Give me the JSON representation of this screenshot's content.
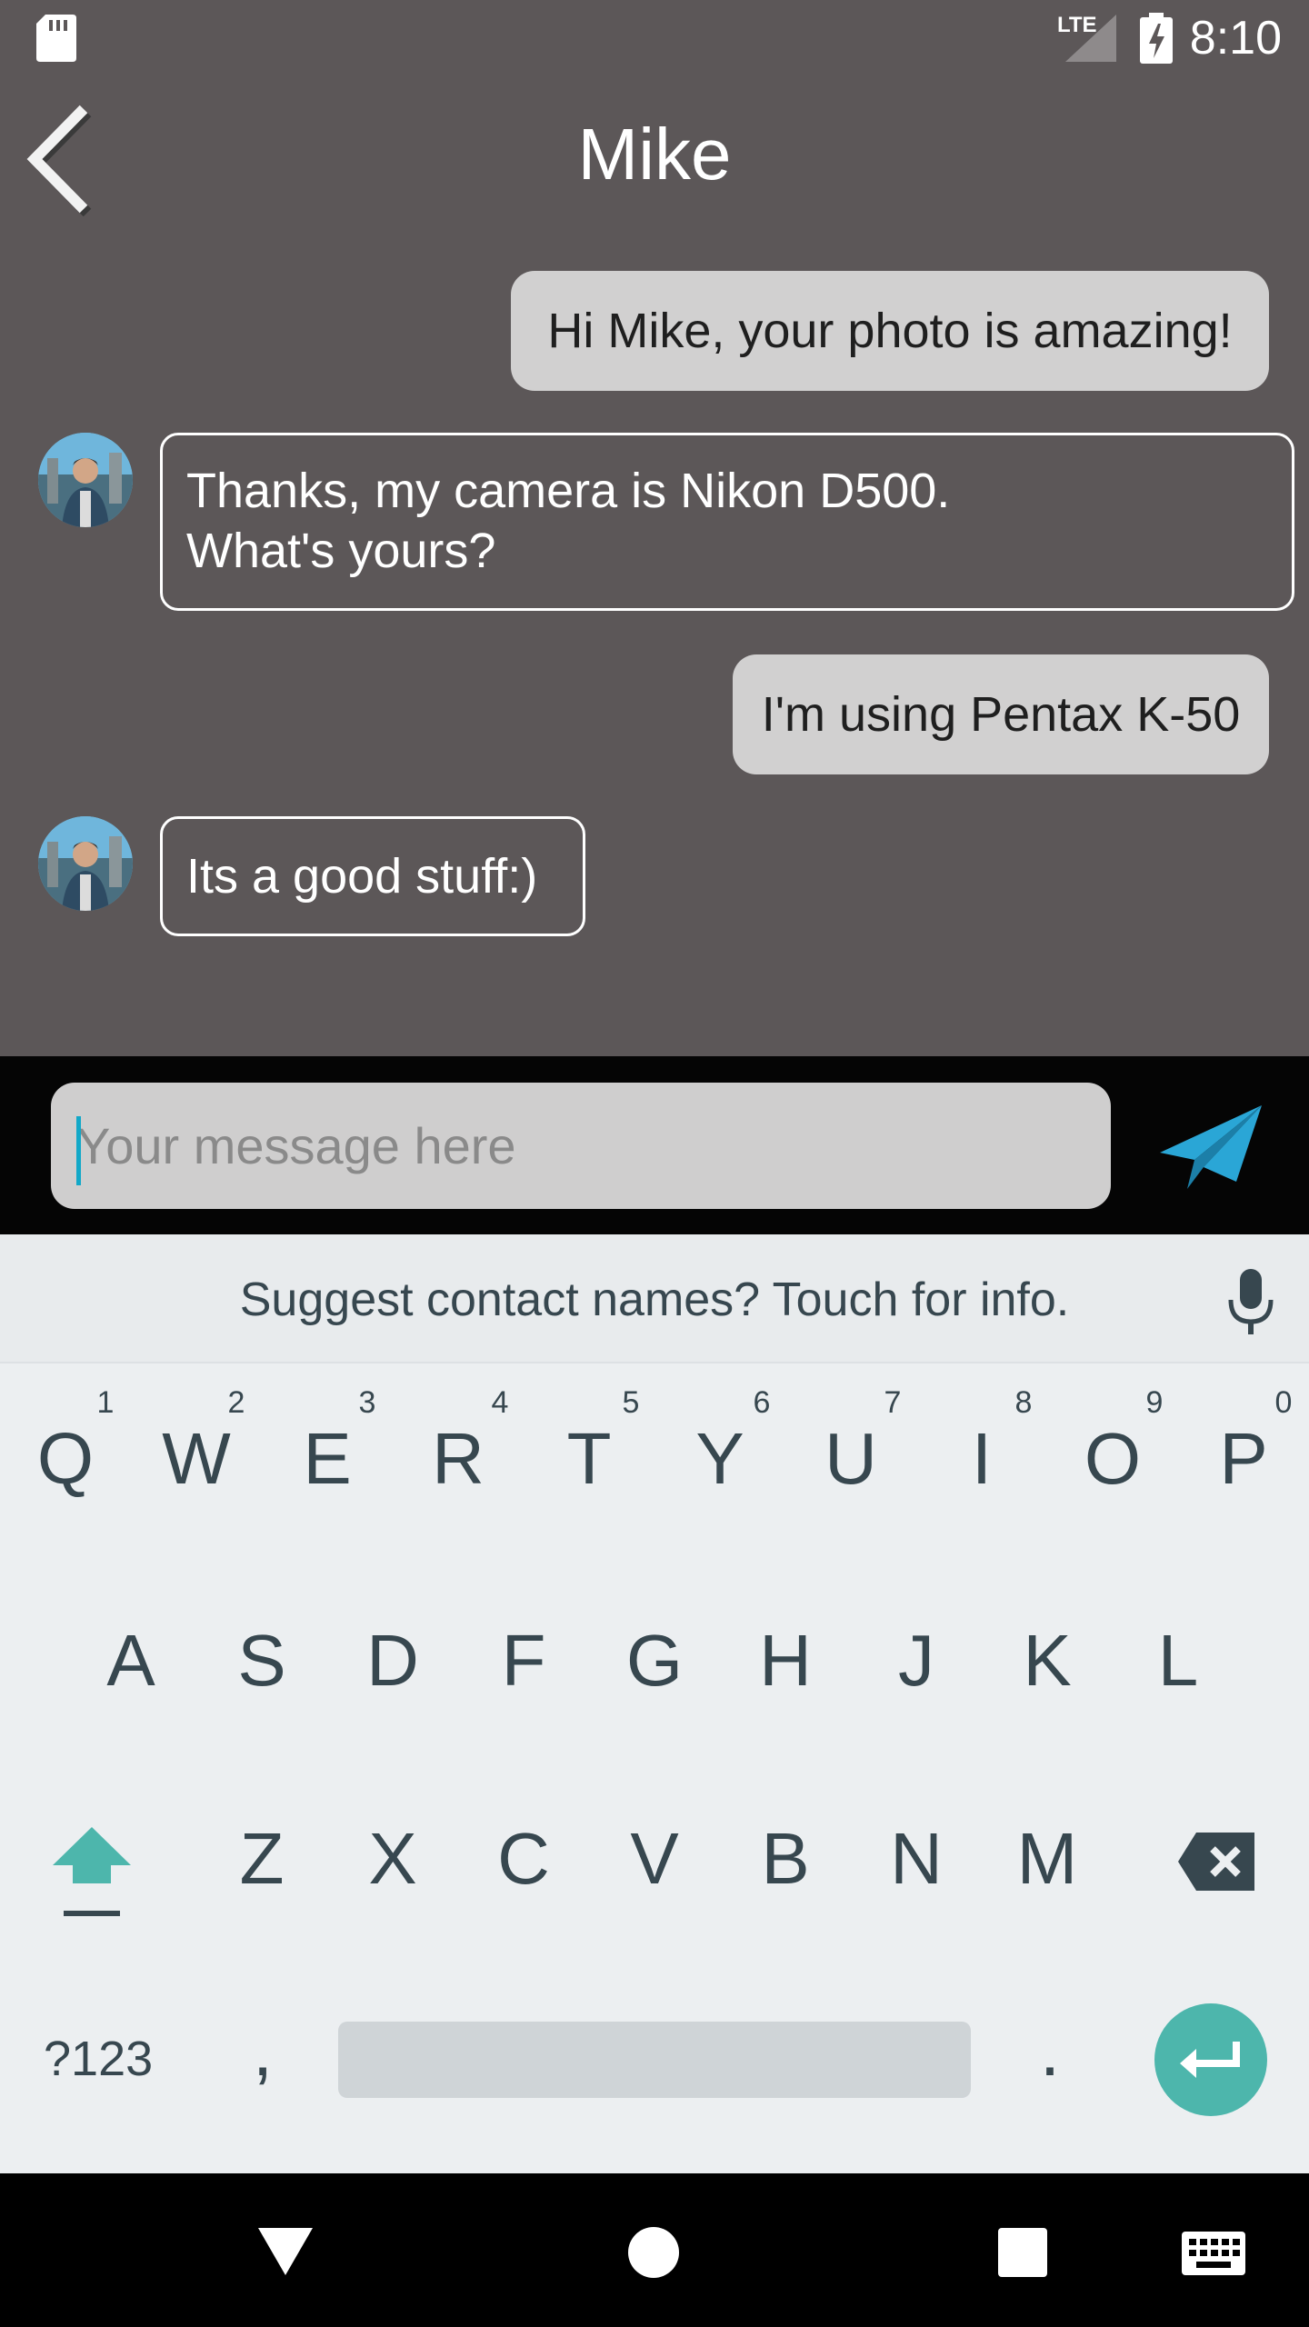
{
  "status_bar": {
    "time": "8:10",
    "network": "LTE"
  },
  "header": {
    "title": "Mike"
  },
  "messages": [
    {
      "from": "me",
      "text": "Hi Mike, your photo is amazing!"
    },
    {
      "from": "Mike",
      "lines": [
        "Thanks, my camera is Nikon D500.",
        "What's yours?"
      ]
    },
    {
      "from": "me",
      "text": "I'm using Pentax K-50"
    },
    {
      "from": "Mike",
      "text": "Its a good stuff:)"
    }
  ],
  "composer": {
    "placeholder": "Your message here"
  },
  "keyboard": {
    "suggestion": "Suggest contact names? Touch for info.",
    "row1": [
      "Q",
      "W",
      "E",
      "R",
      "T",
      "Y",
      "U",
      "I",
      "O",
      "P"
    ],
    "row1_hints": [
      "1",
      "2",
      "3",
      "4",
      "5",
      "6",
      "7",
      "8",
      "9",
      "0"
    ],
    "row2": [
      "A",
      "S",
      "D",
      "F",
      "G",
      "H",
      "J",
      "K",
      "L"
    ],
    "row3": [
      "Z",
      "X",
      "C",
      "V",
      "B",
      "N",
      "M"
    ],
    "symbols_label": "?123",
    "comma": ",",
    "period": "."
  },
  "icons": {
    "back": "chevron-left-icon",
    "send": "paper-plane-icon",
    "mic": "microphone-icon",
    "shift": "shift-icon",
    "backspace": "backspace-icon",
    "enter": "enter-icon",
    "nav_back": "triangle-back-icon",
    "nav_home": "circle-home-icon",
    "nav_recents": "square-recents-icon",
    "nav_keyboard": "keyboard-icon"
  },
  "colors": {
    "chat_background": "#5c5758",
    "sent_bubble": "#d1d0d0",
    "send_icon": "#2aa6d6",
    "enter_key": "#4db6ac",
    "shift_active": "#4db6ac",
    "caret": "#12a8c8"
  }
}
